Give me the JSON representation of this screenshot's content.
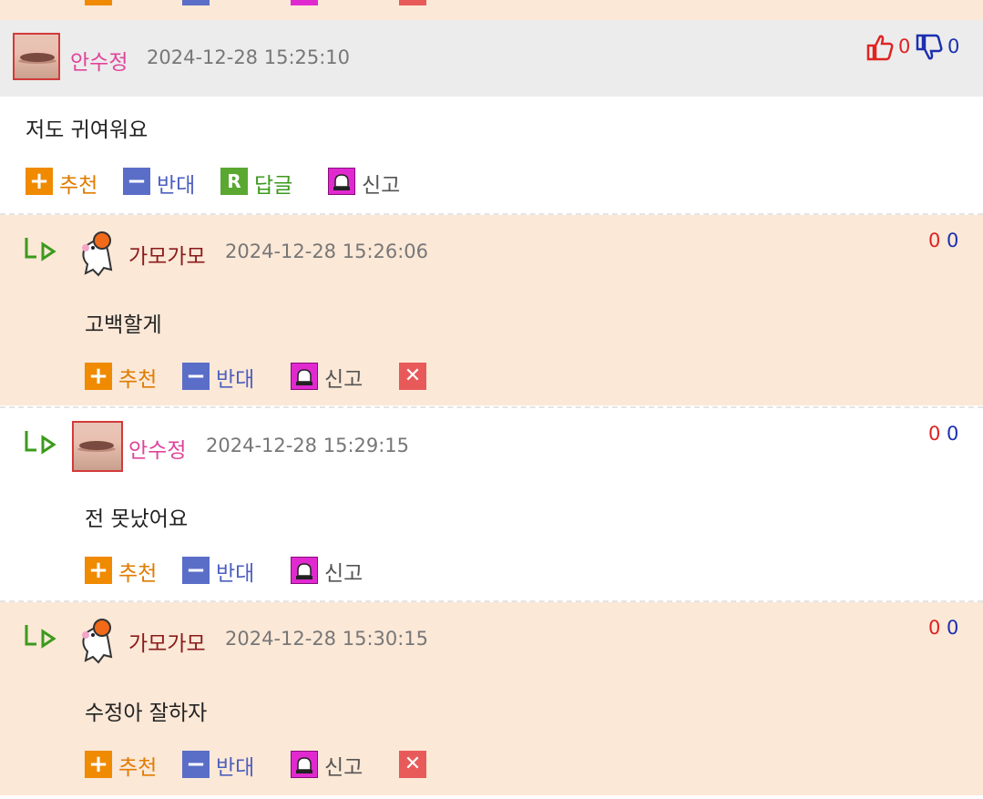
{
  "colors": {
    "peach": "#fbe8d7",
    "header_grey": "#ececec",
    "recommend": "#f08a00",
    "oppose": "#5a6ec8",
    "reply": "#5aa832",
    "report": "#e02ad0",
    "delete": "#e85a5a"
  },
  "main_comment": {
    "author": "안수정",
    "datetime": "2024-12-28 15:25:10",
    "likes": "0",
    "dislikes": "0",
    "text": "저도 귀여워요",
    "actions": {
      "recommend": "추천",
      "oppose": "반대",
      "reply": "답글",
      "report": "신고"
    }
  },
  "replies": [
    {
      "author": "가모가모",
      "datetime": "2024-12-28 15:26:06",
      "text": "고백할게",
      "likes": "0",
      "dislikes": "0",
      "actions": {
        "recommend": "추천",
        "oppose": "반대",
        "report": "신고"
      }
    },
    {
      "author": "안수정",
      "datetime": "2024-12-28 15:29:15",
      "text": "전 못났어요",
      "likes": "0",
      "dislikes": "0",
      "actions": {
        "recommend": "추천",
        "oppose": "반대",
        "report": "신고"
      }
    },
    {
      "author": "가모가모",
      "datetime": "2024-12-28 15:30:15",
      "text": "수정아 잘하자",
      "likes": "0",
      "dislikes": "0",
      "actions": {
        "recommend": "추천",
        "oppose": "반대",
        "report": "신고"
      }
    }
  ],
  "icons": {
    "recommend": "plus-icon",
    "oppose": "minus-icon",
    "reply": "r-icon",
    "report": "siren-icon",
    "delete": "close-icon",
    "reply_arrow": "reply-arrow-icon",
    "like": "thumbs-up-icon",
    "dislike": "thumbs-down-icon"
  }
}
